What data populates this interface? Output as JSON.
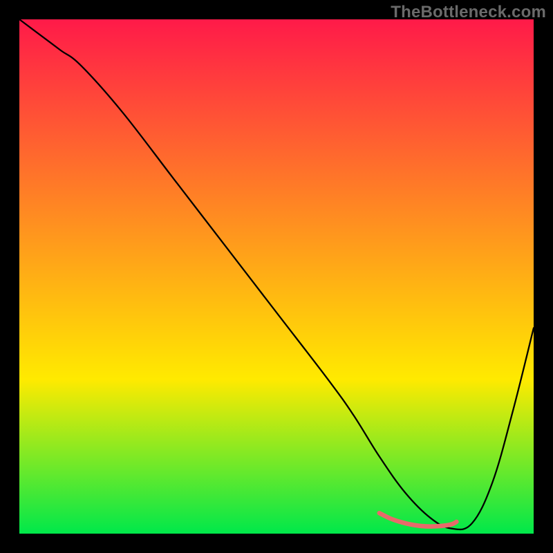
{
  "watermark": "TheBottleneck.com",
  "chart_data": {
    "type": "line",
    "title": "",
    "xlabel": "",
    "ylabel": "",
    "xlim": [
      0,
      100
    ],
    "ylim": [
      0,
      100
    ],
    "grid": false,
    "legend": false,
    "background_gradient": {
      "top": "#ff1a49",
      "middle": "#ffea00",
      "bottom": "#00e84a"
    },
    "series": [
      {
        "name": "bottleneck-curve",
        "color": "#000000",
        "x": [
          0,
          4,
          8,
          12,
          20,
          30,
          40,
          50,
          60,
          65,
          70,
          75,
          80,
          84,
          88,
          92,
          96,
          100
        ],
        "y": [
          100,
          97,
          94,
          91,
          82,
          69,
          56,
          43,
          30,
          23,
          15,
          8,
          3,
          1,
          2,
          10,
          24,
          40
        ]
      },
      {
        "name": "optimal-zone",
        "color": "#e86a6a",
        "x": [
          70,
          72,
          74,
          76,
          78,
          80,
          82,
          84,
          85
        ],
        "y": [
          4.0,
          3.0,
          2.3,
          1.8,
          1.5,
          1.4,
          1.5,
          1.8,
          2.3
        ]
      }
    ]
  }
}
